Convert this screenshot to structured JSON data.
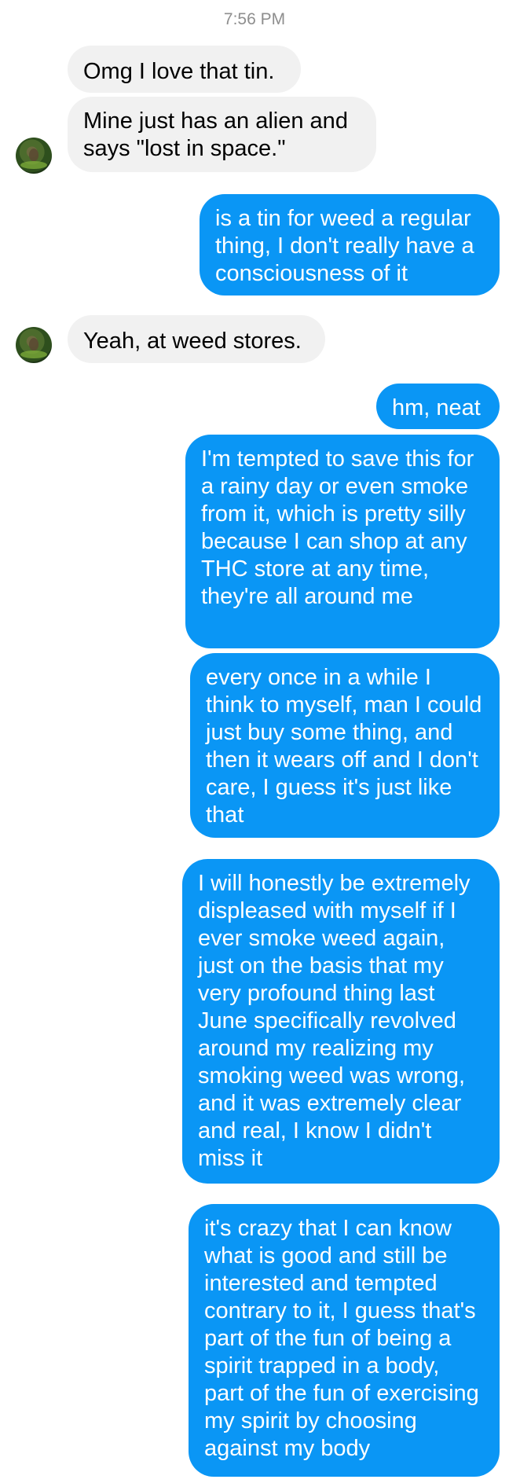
{
  "conversation": {
    "timestamp": "7:56 PM",
    "messages": [
      {
        "sender": "contact",
        "text": "Omg I love that tin."
      },
      {
        "sender": "contact",
        "text": "Mine just has an alien and says \"lost in space.\""
      },
      {
        "sender": "me",
        "text": "is a tin for weed a regular thing, I don't really have a consciousness of it"
      },
      {
        "sender": "contact",
        "text": "Yeah, at weed stores."
      },
      {
        "sender": "me",
        "text": "hm, neat"
      },
      {
        "sender": "me",
        "text": "I'm tempted to save this for a rainy day or even smoke from it, which is pretty silly because I can shop at any THC store at any time, they're all around me"
      },
      {
        "sender": "me",
        "text": "every once in a while I think to myself, man I could just buy some thing, and then it wears off and I don't care, I guess it's just like that"
      },
      {
        "sender": "me",
        "text": "I will honestly be extremely displeased with myself if I ever smoke weed again, just on the basis that my very profound thing last June specifically revolved around my realizing my smoking weed was wrong, and it was extremely clear and real, I know I didn't miss it"
      },
      {
        "sender": "me",
        "text": "it's crazy that I can know what is good and still be interested and tempted contrary to it, I guess that's part of the fun of being a spirit trapped in a body, part of the fun of exercising my spirit by choosing against my body"
      }
    ]
  },
  "colors": {
    "outgoing_bubble": "#0a96f5",
    "incoming_bubble": "#f1f1f1",
    "timestamp_text": "#8e8e8e"
  },
  "icons": {
    "avatar": "contact-avatar-nature-photo"
  }
}
